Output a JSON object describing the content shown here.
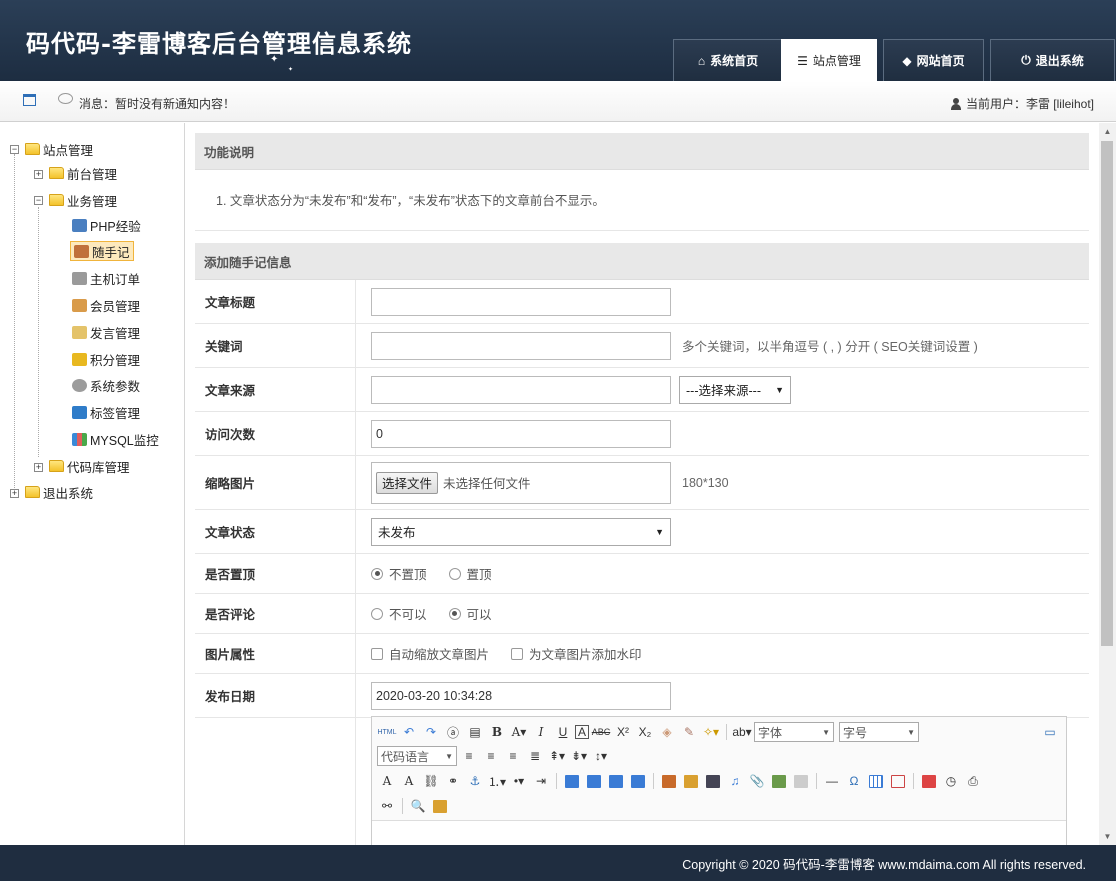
{
  "header": {
    "logo": "码代码-李雷博客后台管理信息系统",
    "nav": [
      {
        "label": "系统首页",
        "icon": "home-icon",
        "glyph": "⌂"
      },
      {
        "label": "站点管理",
        "icon": "list-icon",
        "glyph": "☰"
      },
      {
        "label": "网站首页",
        "icon": "tag-icon",
        "glyph": "◆"
      },
      {
        "label": "退出系统",
        "icon": "power-icon",
        "glyph": "⏻"
      }
    ],
    "active_nav": "站点管理"
  },
  "msgbar": {
    "message": "消息：暂时没有新通知内容！",
    "user": "当前用户：李雷 [lileihot]"
  },
  "sidebar": {
    "root": "站点管理",
    "frontend": "前台管理",
    "business": "业务管理",
    "items": [
      {
        "label": "PHP经验",
        "icon": "html-icon"
      },
      {
        "label": "随手记",
        "icon": "notebook-icon"
      },
      {
        "label": "主机订单",
        "icon": "cart-icon"
      },
      {
        "label": "会员管理",
        "icon": "members-icon"
      },
      {
        "label": "发言管理",
        "icon": "pen-icon"
      },
      {
        "label": "积分管理",
        "icon": "coins-icon"
      },
      {
        "label": "系统参数",
        "icon": "gear-icon"
      },
      {
        "label": "标签管理",
        "icon": "monitor-icon"
      },
      {
        "label": "MYSQL监控",
        "icon": "bar-chart-icon"
      }
    ],
    "codelib": "代码库管理",
    "logout": "退出系统",
    "selected": "随手记"
  },
  "main": {
    "info_title": "功能说明",
    "info_text": "1. 文章状态分为“未发布”和“发布”，“未发布”状态下的文章前台不显示。",
    "form_title": "添加随手记信息",
    "fields": {
      "title_label": "文章标题",
      "title_value": "",
      "keywords_label": "关键词",
      "keywords_value": "",
      "keywords_hint": "多个关键词，以半角逗号 ( , ) 分开 ( SEO关键词设置 )",
      "source_label": "文章来源",
      "source_value": "",
      "source_select": "---选择来源---",
      "visits_label": "访问次数",
      "visits_value": "0",
      "thumb_label": "缩略图片",
      "file_button": "选择文件",
      "file_status": "未选择任何文件",
      "thumb_hint": "180*130",
      "status_label": "文章状态",
      "status_value": "未发布",
      "top_label": "是否置顶",
      "top_options": [
        "不置顶",
        "置顶"
      ],
      "top_selected": "不置顶",
      "comment_label": "是否评论",
      "comment_options": [
        "不可以",
        "可以"
      ],
      "comment_selected": "可以",
      "image_label": "图片属性",
      "image_options": [
        "自动缩放文章图片",
        "为文章图片添加水印"
      ],
      "date_label": "发布日期",
      "date_value": "2020-03-20 10:34:28"
    },
    "editor": {
      "font_select": "字体",
      "size_select": "字号",
      "code_select": "代码语言"
    }
  },
  "footer": {
    "text": "Copyright © 2020 码代码-李雷博客 www.mdaima.com All rights reserved."
  },
  "colors": {
    "header_bg": "#1d2d41",
    "footer_bg": "#1f2d40",
    "section_bg": "#e8e8e8",
    "selected_bg": "#fde9bd"
  }
}
